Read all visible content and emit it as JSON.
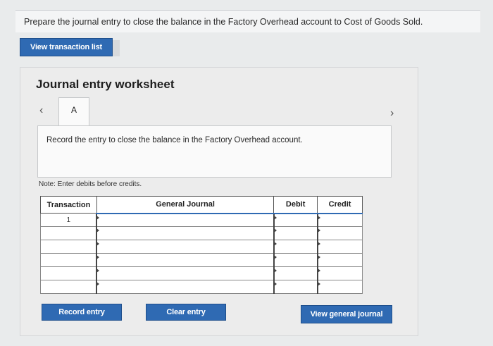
{
  "question": "Prepare the journal entry to close the balance in the Factory Overhead account to Cost of Goods Sold.",
  "view_transaction_list": "View transaction list",
  "worksheet": {
    "title": "Journal entry worksheet",
    "prev_icon": "chevron-left-icon",
    "next_icon": "chevron-right-icon",
    "tab_label": "A",
    "instruction": "Record the entry to close the balance in the Factory Overhead account.",
    "note": "Note: Enter debits before credits."
  },
  "table": {
    "headers": {
      "transaction": "Transaction",
      "general_journal": "General Journal",
      "debit": "Debit",
      "credit": "Credit"
    },
    "rows": [
      {
        "transaction": "1",
        "account": "",
        "debit": "",
        "credit": ""
      },
      {
        "transaction": "",
        "account": "",
        "debit": "",
        "credit": ""
      },
      {
        "transaction": "",
        "account": "",
        "debit": "",
        "credit": ""
      },
      {
        "transaction": "",
        "account": "",
        "debit": "",
        "credit": ""
      },
      {
        "transaction": "",
        "account": "",
        "debit": "",
        "credit": ""
      },
      {
        "transaction": "",
        "account": "",
        "debit": "",
        "credit": ""
      }
    ]
  },
  "buttons": {
    "record": "Record entry",
    "clear": "Clear entry",
    "view_general_journal": "View general journal"
  },
  "colors": {
    "button_blue": "#2f6ab3"
  }
}
